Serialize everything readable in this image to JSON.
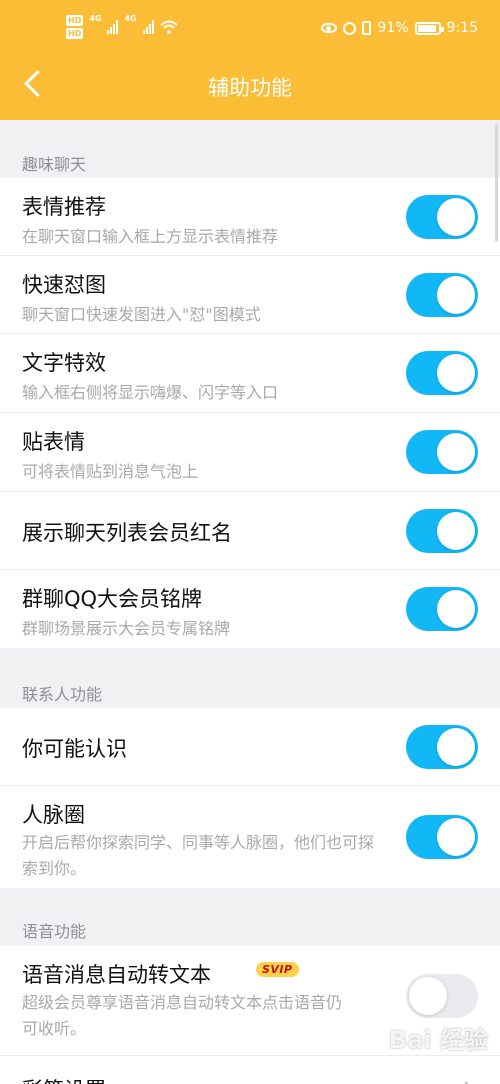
{
  "status_bar": {
    "left_badges": [
      "HD",
      "HD"
    ],
    "network": [
      "4G",
      "4G"
    ],
    "battery": "91%",
    "time": "9:15",
    "battery_level": 0.91,
    "icons": [
      "wifi-icon",
      "eye-icon",
      "alarm-icon",
      "vibrate-icon",
      "battery-icon"
    ]
  },
  "header": {
    "title": "辅助功能",
    "back_icon": "chevron-left-icon",
    "color": "#fbbd35"
  },
  "sections": [
    {
      "title": "趣味聊天",
      "items": [
        {
          "label": "表情推荐",
          "desc": "在聊天窗口输入框上方显示表情推荐",
          "on": true
        },
        {
          "label": "快速怼图",
          "desc": "聊天窗口快速发图进入\"怼\"图模式",
          "on": true
        },
        {
          "label": "文字特效",
          "desc": "输入框右侧将显示嗨爆、闪字等入口",
          "on": true
        },
        {
          "label": "贴表情",
          "desc": "可将表情贴到消息气泡上",
          "on": true
        },
        {
          "label": "展示聊天列表会员红名",
          "desc": "",
          "on": true
        },
        {
          "label": "群聊QQ大会员铭牌",
          "desc": "群聊场景展示大会员专属铭牌",
          "on": true
        }
      ]
    },
    {
      "title": "联系人功能",
      "items": [
        {
          "label": "你可能认识",
          "desc": "",
          "on": true
        },
        {
          "label": "人脉圈",
          "desc": "开启后帮你探索同学、同事等人脉圈，他们也可探索到你。",
          "on": true
        }
      ]
    },
    {
      "title": "语音功能",
      "items": [
        {
          "label": "语音消息自动转文本",
          "badge": "SVIP",
          "desc": "超级会员尊享语音消息自动转文本点击语音仍可收听。",
          "on": false
        },
        {
          "label": "彩签设置",
          "desc": ""
        }
      ]
    }
  ],
  "watermark": "Bai 经验",
  "colors": {
    "toggle_on": "#12b7f5",
    "toggle_off": "#e9e9ee",
    "badge": "#ffd14a"
  }
}
